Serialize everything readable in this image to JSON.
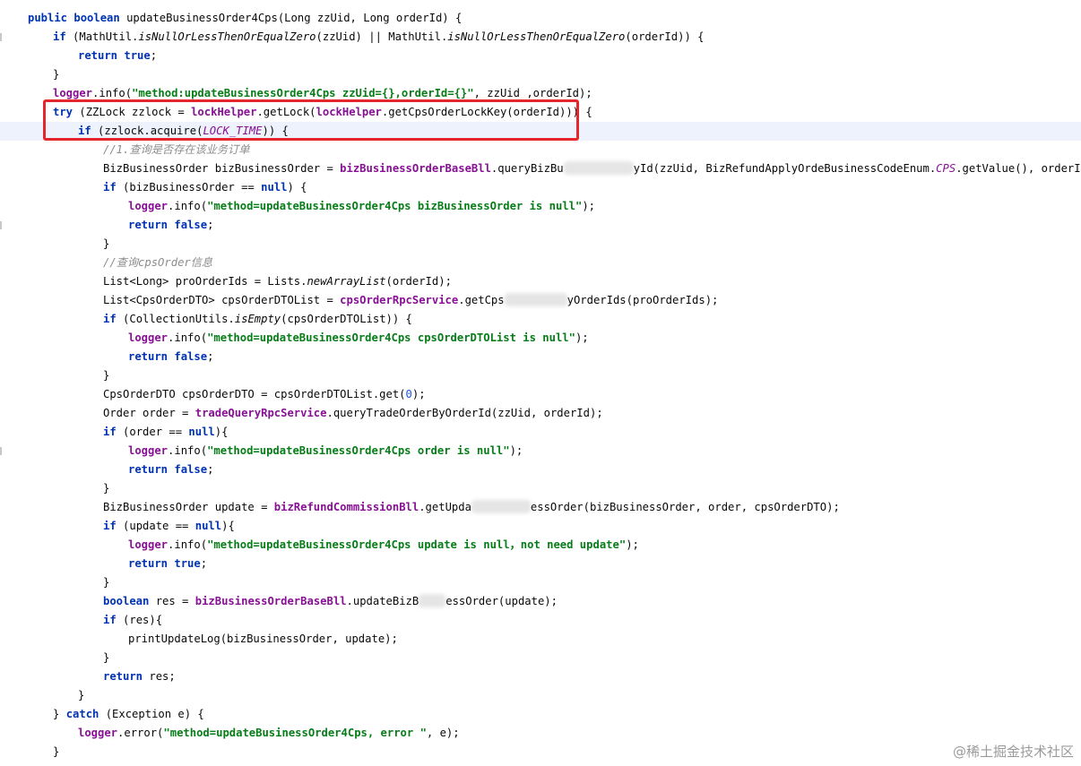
{
  "code": {
    "line1": {
      "t0": "public",
      "t1": " ",
      "t2": "boolean",
      "t3": " updateBusinessOrder4Cps(Long zzUid, Long orderId) {"
    },
    "line2": {
      "t0": "if",
      "t1": " (MathUtil.",
      "t2": "isNullOrLessThenOrEqualZero",
      "t3": "(zzUid) || MathUtil.",
      "t4": "isNullOrLessThenOrEqualZero",
      "t5": "(orderId)) {"
    },
    "line3": {
      "t0": "return",
      "t1": " ",
      "t2": "true",
      "t3": ";"
    },
    "line4": {
      "t0": "}"
    },
    "line5": {
      "t0": "logger",
      "t1": ".info(",
      "t2": "\"method:updateBusinessOrder4Cps zzUid={},orderId={}\"",
      "t3": ", zzUid ,orderId);"
    },
    "line6": {
      "t0": "try",
      "t1": " (ZZLock zzlock = ",
      "t2": "lockHelper",
      "t3": ".getLock(",
      "t4": "lockHelper",
      "t5": ".getCpsOrderLockKey(orderId))) {"
    },
    "line7": {
      "t0": "if",
      "t1": " (zzlock.acquire(",
      "t2": "LOCK_TIME",
      "t3": ")) {"
    },
    "line8": {
      "t0": "//1.查询是否存在该业务订单"
    },
    "line9": {
      "t0": "BizBusinessOrder bizBusinessOrder = ",
      "t1": "bizBusinessOrderBaseBll",
      "t2": ".queryBizBu",
      "t3": "yId(zzUid, BizRefundApplyOrdeBusinessCodeEnum.",
      "t4": "CPS",
      "t5": ".getValue(), orderId);"
    },
    "line10": {
      "t0": "if",
      "t1": " (bizBusinessOrder == ",
      "t2": "null",
      "t3": ") {"
    },
    "line11": {
      "t0": "logger",
      "t1": ".info(",
      "t2": "\"method=updateBusinessOrder4Cps bizBusinessOrder is null\"",
      "t3": ");"
    },
    "line12": {
      "t0": "return",
      "t1": " ",
      "t2": "false",
      "t3": ";"
    },
    "line13": {
      "t0": "}"
    },
    "line14": {
      "t0": "//查询cpsOrder信息"
    },
    "line15": {
      "t0": "List<Long> proOrderIds = Lists.",
      "t1": "newArrayList",
      "t2": "(orderId);"
    },
    "line16": {
      "t0": "List<CpsOrderDTO> cpsOrderDTOList = ",
      "t1": "cpsOrderRpcService",
      "t2": ".getCps",
      "t3": "yOrderIds(proOrderIds);"
    },
    "line17": {
      "t0": "if",
      "t1": " (CollectionUtils.",
      "t2": "isEmpty",
      "t3": "(cpsOrderDTOList)) {"
    },
    "line18": {
      "t0": "logger",
      "t1": ".info(",
      "t2": "\"method=updateBusinessOrder4Cps cpsOrderDTOList is null\"",
      "t3": ");"
    },
    "line19": {
      "t0": "return",
      "t1": " ",
      "t2": "false",
      "t3": ";"
    },
    "line20": {
      "t0": "}"
    },
    "line21": {
      "t0": "CpsOrderDTO cpsOrderDTO = cpsOrderDTOList.get(",
      "t1": "0",
      "t2": ");"
    },
    "line22": {
      "t0": "Order order = ",
      "t1": "tradeQueryRpcService",
      "t2": ".queryTradeOrderByOrderId(zzUid, orderId);"
    },
    "line23": {
      "t0": "if",
      "t1": " (order == ",
      "t2": "null",
      "t3": "){"
    },
    "line24": {
      "t0": "logger",
      "t1": ".info(",
      "t2": "\"method=updateBusinessOrder4Cps order is null\"",
      "t3": ");"
    },
    "line25": {
      "t0": "return",
      "t1": " ",
      "t2": "false",
      "t3": ";"
    },
    "line26": {
      "t0": "}"
    },
    "line27": {
      "t0": "BizBusinessOrder update = ",
      "t1": "bizRefundCommissionBll",
      "t2": ".getUpda",
      "t3": "essOrder(bizBusinessOrder, order, cpsOrderDTO);"
    },
    "line28": {
      "t0": "if",
      "t1": " (update == ",
      "t2": "null",
      "t3": "){"
    },
    "line29": {
      "t0": "logger",
      "t1": ".info(",
      "t2": "\"method=updateBusinessOrder4Cps update is null，not need update\"",
      "t3": ");"
    },
    "line30": {
      "t0": "return",
      "t1": " ",
      "t2": "true",
      "t3": ";"
    },
    "line31": {
      "t0": "}"
    },
    "line32": {
      "t0": "boolean",
      "t1": " res = ",
      "t2": "bizBusinessOrderBaseBll",
      "t3": ".updateBizB",
      "t4": "essOrder(update);"
    },
    "line33": {
      "t0": "if",
      "t1": " (res){"
    },
    "line34": {
      "t0": "printUpdateLog(bizBusinessOrder, update);"
    },
    "line35": {
      "t0": "}"
    },
    "line36": {
      "t0": "return",
      "t1": " res;"
    },
    "line37": {
      "t0": "}"
    },
    "line38": {
      "t0": "} ",
      "t1": "catch",
      "t2": " (Exception e) {"
    },
    "line39": {
      "t0": "logger",
      "t1": ".error(",
      "t2": "\"method=updateBusinessOrder4Cps, error \"",
      "t3": ", e);"
    },
    "line40": {
      "t0": "}"
    }
  },
  "watermark": "@稀土掘金技术社区",
  "colors": {
    "keyword": "#0033b3",
    "string": "#067d17",
    "field": "#871094",
    "number": "#1750eb",
    "comment": "#8c8c8c",
    "current_line": "#edf2fc",
    "highlight_box": "#e5262d"
  }
}
